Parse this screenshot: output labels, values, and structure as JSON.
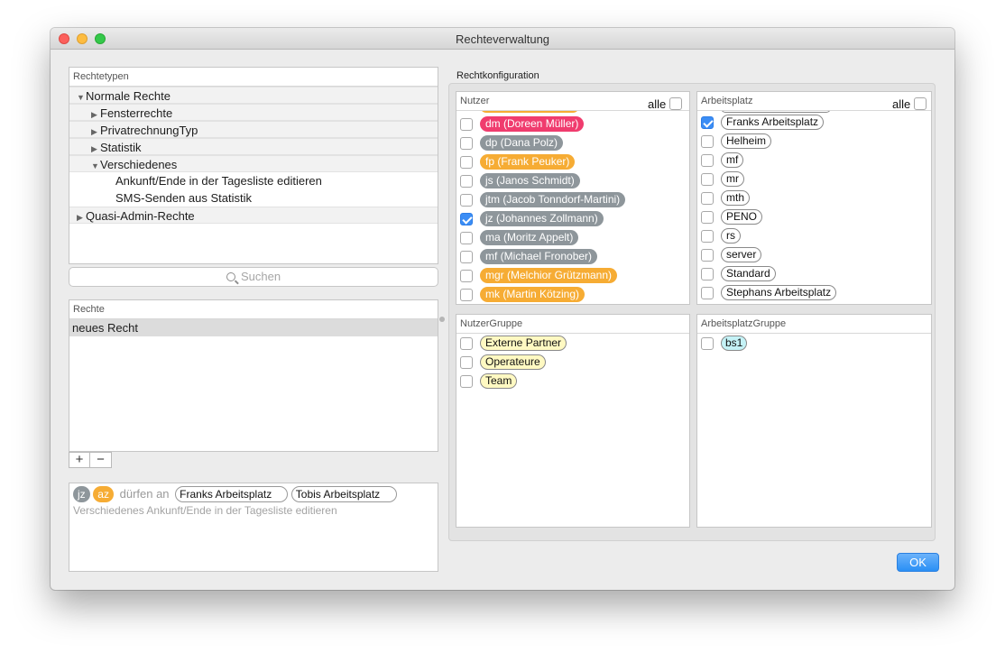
{
  "window": {
    "title": "Rechteverwaltung"
  },
  "rechtetypen": {
    "header": "Rechtetypen",
    "rows": [
      {
        "label": "Normale Rechte",
        "indent": 0,
        "expanded": true,
        "group": true
      },
      {
        "label": "Fensterrechte",
        "indent": 1,
        "expanded": false,
        "group": true
      },
      {
        "label": "PrivatrechnungTyp",
        "indent": 1,
        "expanded": false,
        "group": true
      },
      {
        "label": "Statistik",
        "indent": 1,
        "expanded": false,
        "group": true
      },
      {
        "label": "Verschiedenes",
        "indent": 1,
        "expanded": true,
        "group": true
      },
      {
        "label": "Ankunft/Ende in der Tagesliste editieren",
        "indent": 2,
        "group": false
      },
      {
        "label": "SMS-Senden aus Statistik",
        "indent": 2,
        "group": false
      },
      {
        "label": "Quasi-Admin-Rechte",
        "indent": 0,
        "expanded": false,
        "group": true
      }
    ]
  },
  "search": {
    "placeholder": "Suchen"
  },
  "rechte": {
    "header": "Rechte",
    "items": [
      "neues Recht"
    ]
  },
  "buttons": {
    "add": "+",
    "remove": "−",
    "ok": "OK"
  },
  "summary": {
    "badges": [
      {
        "label": "jz",
        "color": "#8e969b"
      },
      {
        "label": "az",
        "color": "#f6ac34"
      }
    ],
    "verb": "dürfen an",
    "places": [
      "Franks Arbeitsplatz",
      "Tobis Arbeitsplatz"
    ],
    "description": "Verschiedenes Ankunft/Ende in der Tagesliste editieren"
  },
  "config": {
    "label": "Rechtkonfiguration",
    "alle": "alle",
    "nutzer": {
      "header": "Nutzer",
      "items": [
        {
          "label": "dm (Doreen Müller)",
          "color": "#f03c6e",
          "checked": false
        },
        {
          "label": "dp (Dana Polz)",
          "color": "#8e969b",
          "checked": false
        },
        {
          "label": "fp (Frank Peuker)",
          "color": "#f6ac34",
          "checked": false
        },
        {
          "label": "js (Janos Schmidt)",
          "color": "#8e969b",
          "checked": false
        },
        {
          "label": "jtm (Jacob Tonndorf-Martini)",
          "color": "#8e969b",
          "checked": false
        },
        {
          "label": "jz (Johannes Zollmann)",
          "color": "#8e969b",
          "checked": true
        },
        {
          "label": "ma (Moritz Appelt)",
          "color": "#8e969b",
          "checked": false
        },
        {
          "label": "mf (Michael Fronober)",
          "color": "#8e969b",
          "checked": false
        },
        {
          "label": "mgr (Melchior Grützmann)",
          "color": "#f6ac34",
          "checked": false
        },
        {
          "label": "mk (Martin Kötzing)",
          "color": "#f6ac34",
          "checked": false
        }
      ]
    },
    "arbeitsplatz": {
      "header": "Arbeitsplatz",
      "items": [
        {
          "label": "Franks Arbeitsplatz",
          "checked": true
        },
        {
          "label": "Helheim",
          "checked": false
        },
        {
          "label": "mf",
          "checked": false
        },
        {
          "label": "mr",
          "checked": false
        },
        {
          "label": "mth",
          "checked": false
        },
        {
          "label": "PENO",
          "checked": false
        },
        {
          "label": "rs",
          "checked": false
        },
        {
          "label": "server",
          "checked": false
        },
        {
          "label": "Standard",
          "checked": false
        },
        {
          "label": "Stephans Arbeitsplatz",
          "checked": false
        }
      ]
    },
    "nutzergruppe": {
      "header": "NutzerGruppe",
      "items": [
        {
          "label": "Externe Partner",
          "checked": false
        },
        {
          "label": "Operateure",
          "checked": false
        },
        {
          "label": "Team",
          "checked": false
        }
      ]
    },
    "arbeitsplatzgruppe": {
      "header": "ArbeitsplatzGruppe",
      "items": [
        {
          "label": "bs1",
          "checked": false
        }
      ]
    }
  }
}
